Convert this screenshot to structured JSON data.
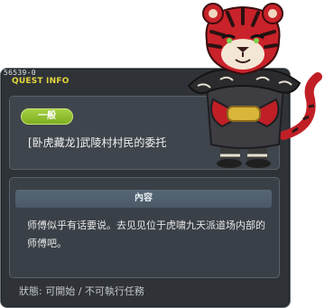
{
  "quest": {
    "id": "56539-0",
    "panel_title": "QUEST INFO",
    "category_badge": "一般",
    "name": "[卧虎藏龙]武陵村村民的委托",
    "content_header": "內容",
    "content_text": "师傅似乎有话要说。去见见位于虎啸九天派道场内部的师傅吧。",
    "status": "狀態:  可開始  /  不可執行任務"
  },
  "colors": {
    "window_bg": "#2f3338",
    "title_yellow": "#e5d63e",
    "badge_green": "#8dbb2c",
    "header_blue": "#4e5e6b"
  },
  "npc": {
    "icon": "tiger-master-npc"
  }
}
